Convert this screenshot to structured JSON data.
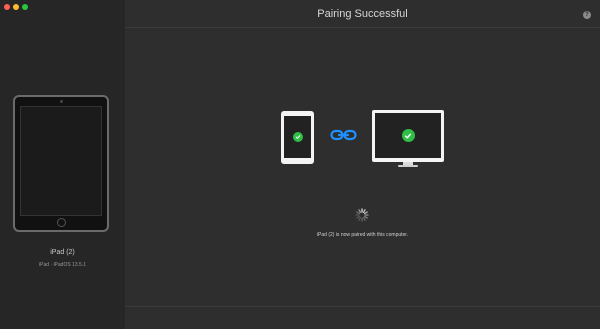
{
  "window": {
    "title": "Pairing Successful"
  },
  "sidebar": {
    "device_name": "iPad (2)",
    "device_os": "iPad · iPadOS 13.5.1"
  },
  "main": {
    "status_message": "iPad (2) is now paired with this computer."
  },
  "icons": {
    "help": "?",
    "check": "checkmark-icon",
    "link": "link-icon"
  },
  "colors": {
    "success": "#2fbf46",
    "link": "#1e90ff"
  }
}
